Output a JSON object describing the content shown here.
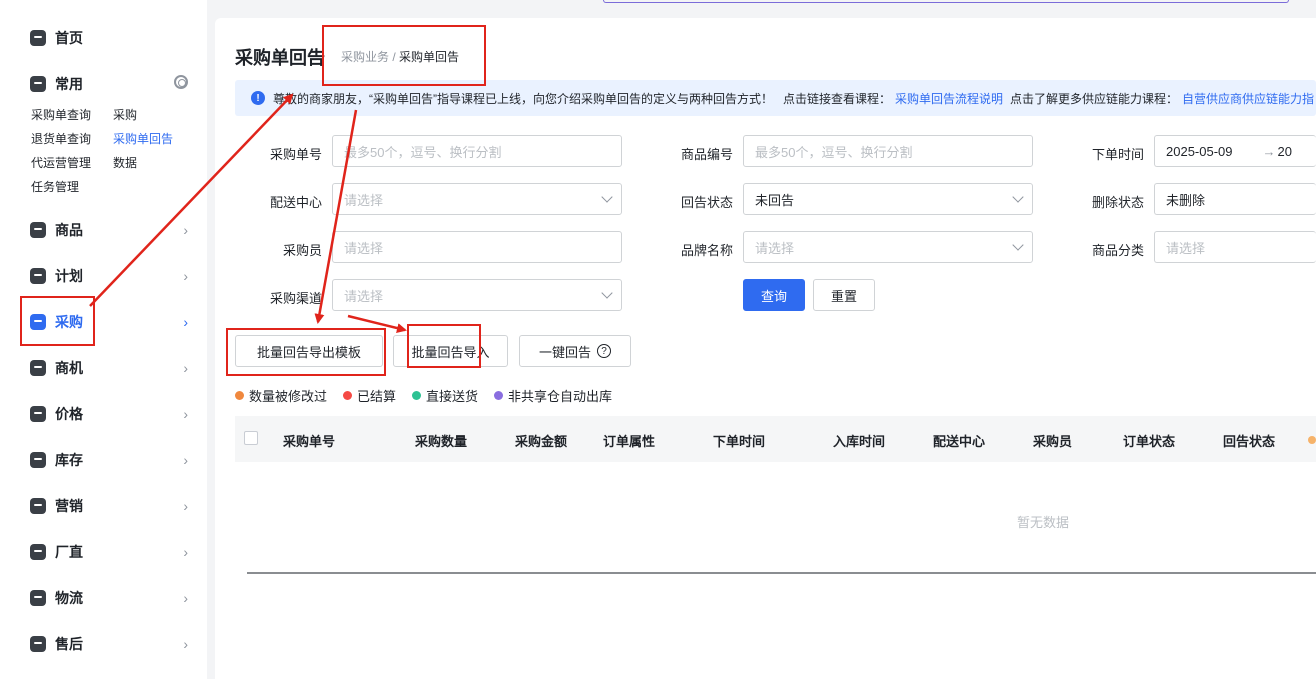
{
  "sidebar": {
    "items": [
      {
        "label": "首页",
        "icon": "home-icon"
      },
      {
        "label": "常用",
        "icon": "star-icon"
      },
      {
        "label": "商品",
        "icon": "product-icon"
      },
      {
        "label": "计划",
        "icon": "plan-icon"
      },
      {
        "label": "采购",
        "icon": "purchase-icon",
        "active": true
      },
      {
        "label": "商机",
        "icon": "opportunity-icon"
      },
      {
        "label": "价格",
        "icon": "price-icon"
      },
      {
        "label": "库存",
        "icon": "inventory-icon"
      },
      {
        "label": "营销",
        "icon": "marketing-icon"
      },
      {
        "label": "厂直",
        "icon": "factory-icon"
      },
      {
        "label": "物流",
        "icon": "logistics-icon"
      },
      {
        "label": "售后",
        "icon": "after-sales-icon"
      }
    ],
    "quick_links": [
      "采购单查询",
      "采购",
      "退货单查询",
      "采购单回告",
      "代运营管理",
      "数据",
      "任务管理"
    ]
  },
  "header": {
    "title": "采购单回告",
    "breadcrumb_parent": "采购业务",
    "breadcrumb_sep": "/",
    "breadcrumb_current": "采购单回告"
  },
  "notice": {
    "text1": "尊敬的商家朋友，“采购单回告”指导课程已上线，向您介绍采购单回告的定义与两种回告方式！",
    "text2": "点击链接查看课程：",
    "link1": "采购单回告流程说明",
    "text3": "点击了解更多供应链能力课程：",
    "link2": "自营供应商供应链能力指"
  },
  "filters": {
    "order_no": {
      "label": "采购单号",
      "placeholder": "最多50个，逗号、换行分割"
    },
    "product_no": {
      "label": "商品编号",
      "placeholder": "最多50个，逗号、换行分割"
    },
    "order_time": {
      "label": "下单时间",
      "start": "2025-05-09",
      "arrow": "→",
      "end": "20"
    },
    "dc": {
      "label": "配送中心",
      "placeholder": "请选择"
    },
    "reply_status": {
      "label": "回告状态",
      "value": "未回告"
    },
    "delete_status": {
      "label": "删除状态",
      "value": "未删除"
    },
    "buyer": {
      "label": "采购员",
      "placeholder": "请选择"
    },
    "brand": {
      "label": "品牌名称",
      "placeholder": "请选择"
    },
    "category": {
      "label": "商品分类",
      "placeholder": "请选择"
    },
    "channel": {
      "label": "采购渠道",
      "placeholder": "请选择"
    }
  },
  "buttons": {
    "query": "查询",
    "reset": "重置",
    "export_template": "批量回告导出模板",
    "batch_import": "批量回告导入",
    "one_click": "一键回告",
    "help": "?"
  },
  "legend": [
    {
      "label": "数量被修改过",
      "color": "#f0883e"
    },
    {
      "label": "已结算",
      "color": "#f54a45"
    },
    {
      "label": "直接送货",
      "color": "#2ec293"
    },
    {
      "label": "非共享仓自动出库",
      "color": "#8a6ee0"
    }
  ],
  "table": {
    "columns": [
      "采购单号",
      "采购数量",
      "采购金额",
      "订单属性",
      "下单时间",
      "入库时间",
      "配送中心",
      "采购员",
      "订单状态",
      "回告状态"
    ],
    "empty_text": "暂无数据"
  },
  "colors": {
    "accent": "#2f6bf0",
    "annotation": "#e0241b"
  }
}
